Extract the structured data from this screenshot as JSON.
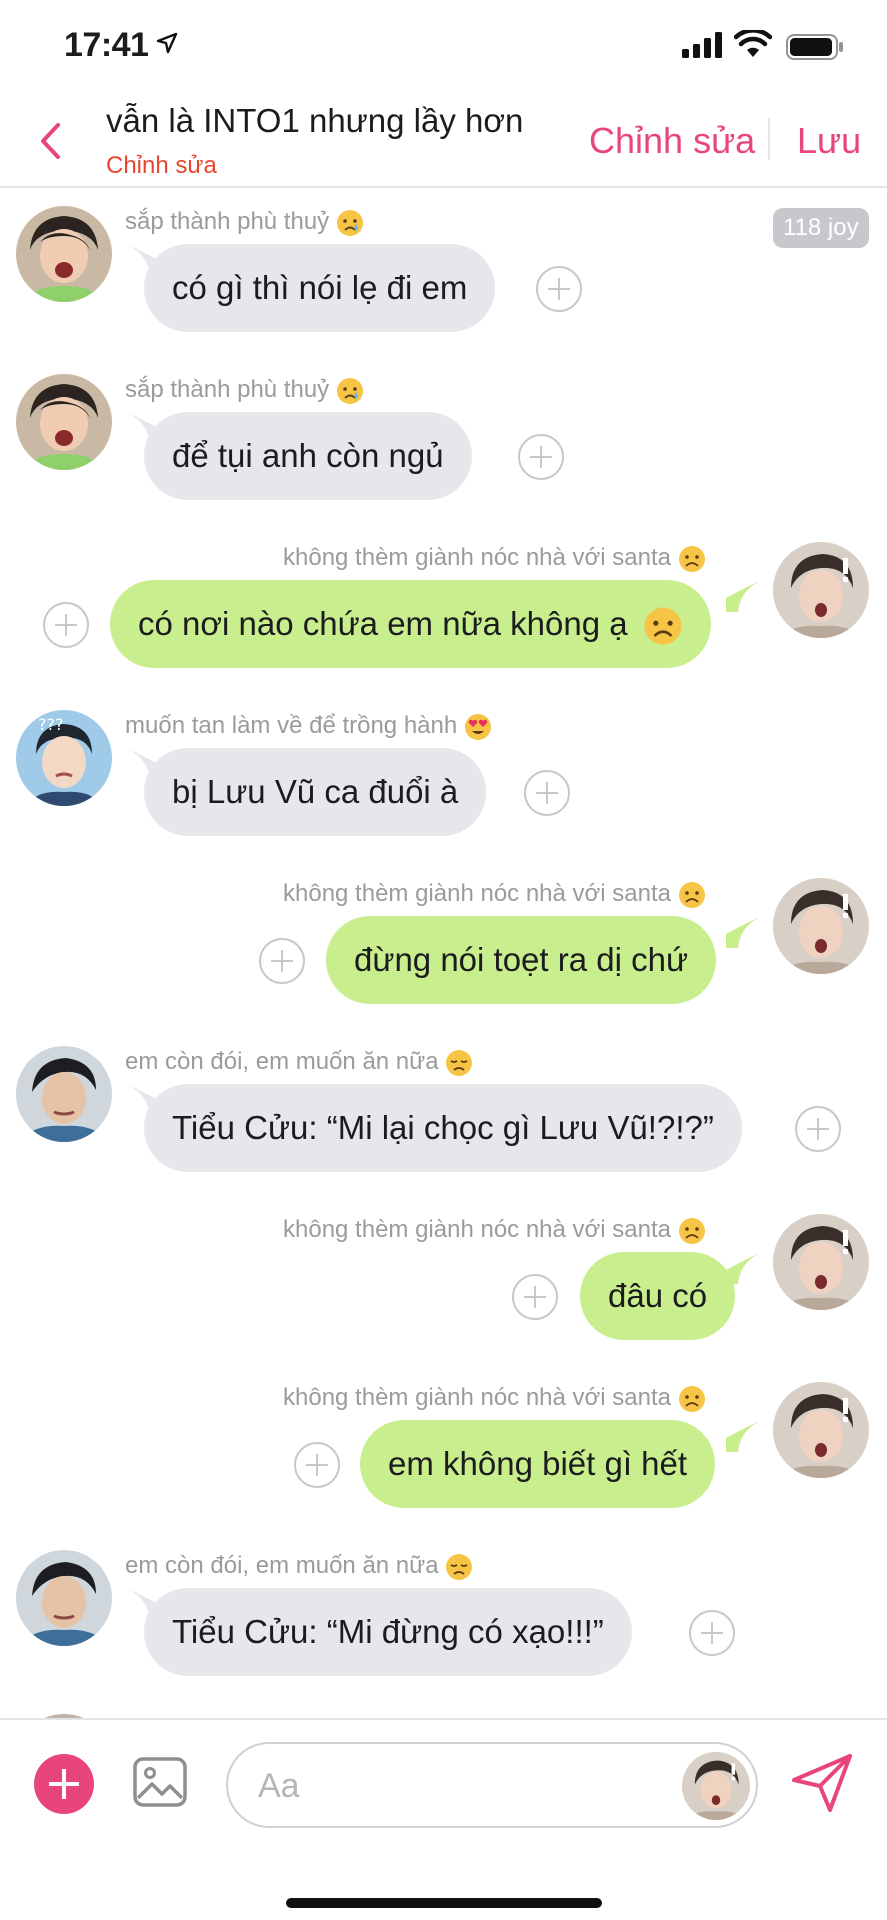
{
  "status_bar": {
    "time": "17:41"
  },
  "header": {
    "back_icon": "chevron-left-icon",
    "title": "vẫn là INTO1 nhưng lầy hơn",
    "subtitle": "Chỉnh sửa",
    "edit_label": "Chỉnh sửa",
    "save_label": "Lưu"
  },
  "chat": {
    "joy_badge": "118 joy",
    "messages": [
      {
        "side": "in",
        "sender": "sắp thành phù thuỷ",
        "sender_emoji": "crying-face",
        "text": "có gì thì nói lẹ đi em",
        "text_emoji": ""
      },
      {
        "side": "in",
        "sender": "sắp thành phù thuỷ",
        "sender_emoji": "crying-face",
        "text": "để tụi anh còn ngủ",
        "text_emoji": ""
      },
      {
        "side": "out",
        "sender": "không thèm giành nóc nhà với santa",
        "sender_emoji": "frowning-face",
        "text": "có nơi nào chứa em nữa không ạ",
        "text_emoji": "frowning-face"
      },
      {
        "side": "in",
        "sender": "muốn tan làm về để trồng hành",
        "sender_emoji": "heart-eyes-face",
        "text": "bị Lưu Vũ ca đuổi à",
        "text_emoji": ""
      },
      {
        "side": "out",
        "sender": "không thèm giành nóc nhà với santa",
        "sender_emoji": "frowning-face",
        "text": "đừng nói toẹt ra dị chứ",
        "text_emoji": ""
      },
      {
        "side": "in",
        "sender": "em còn đói, em muốn ăn nữa",
        "sender_emoji": "disappointed-face",
        "text": "Tiểu Cửu: “Mi lại chọc gì Lưu Vũ!?!?”",
        "text_emoji": ""
      },
      {
        "side": "out",
        "sender": "không thèm giành nóc nhà với santa",
        "sender_emoji": "frowning-face",
        "text": "đâu có",
        "text_emoji": ""
      },
      {
        "side": "out",
        "sender": "không thèm giành nóc nhà với santa",
        "sender_emoji": "frowning-face",
        "text": "em không biết gì hết",
        "text_emoji": ""
      },
      {
        "side": "in",
        "sender": "em còn đói, em muốn ăn nữa",
        "sender_emoji": "disappointed-face",
        "text": "Tiểu Cửu: “Mi đừng có xạo!!!”",
        "text_emoji": ""
      }
    ]
  },
  "composer": {
    "add_icon": "plus-icon",
    "image_icon": "image-icon",
    "placeholder": "Aa",
    "send_icon": "send-icon"
  },
  "colors": {
    "accent": "#e8457f",
    "subtitle": "#e8462e",
    "bubble_in": "#e5e7eb",
    "bubble_out": "#c8ee8e"
  }
}
